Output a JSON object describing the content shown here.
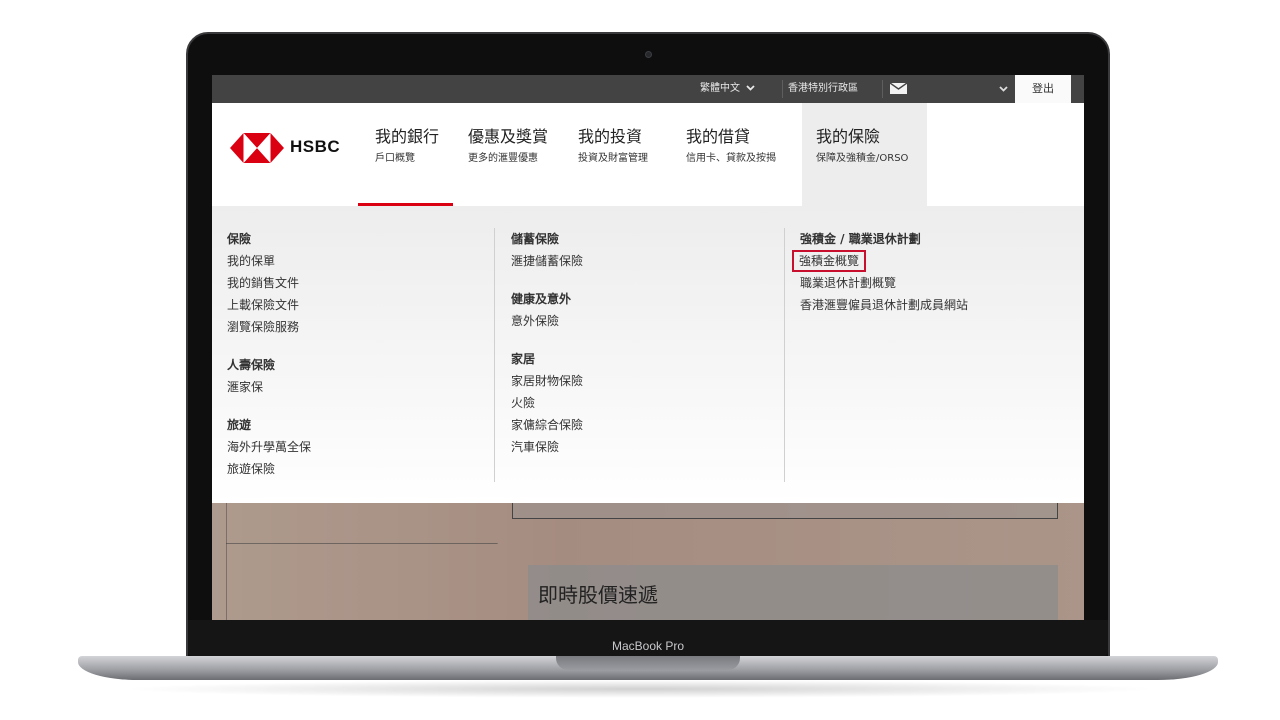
{
  "device": {
    "label": "MacBook Pro"
  },
  "topbar": {
    "language": "繁體中文",
    "region": "香港特別行政區",
    "icons": {
      "dropdown": "chevron-down-icon",
      "mail": "mail-icon"
    },
    "logout": "登出"
  },
  "brand": {
    "name": "HSBC",
    "color": "#db0011"
  },
  "nav": [
    {
      "title": "我的銀行",
      "subtitle": "戶口概覽"
    },
    {
      "title": "優惠及獎賞",
      "subtitle": "更多的滙豐優惠"
    },
    {
      "title": "我的投資",
      "subtitle": "投資及財富管理"
    },
    {
      "title": "我的借貸",
      "subtitle": "信用卡、貸款及按揭"
    },
    {
      "title": "我的保險",
      "subtitle": "保障及強積金/ORSO"
    }
  ],
  "megamenu": {
    "col1": {
      "sec1": {
        "heading": "保險",
        "links": [
          "我的保單",
          "我的銷售文件",
          "上載保險文件",
          "瀏覽保險服務"
        ]
      },
      "sec2": {
        "heading": "人壽保險",
        "links": [
          "滙家保"
        ]
      },
      "sec3": {
        "heading": "旅遊",
        "links": [
          "海外升學萬全保",
          "旅遊保險"
        ]
      }
    },
    "col2": {
      "sec1": {
        "heading": "儲蓄保險",
        "links": [
          "滙捷儲蓄保險"
        ]
      },
      "sec2": {
        "heading": "健康及意外",
        "links": [
          "意外保險"
        ]
      },
      "sec3": {
        "heading": "家居",
        "links": [
          "家居財物保險",
          "火險",
          "家傭綜合保險",
          "汽車保險"
        ]
      }
    },
    "col3": {
      "sec1": {
        "heading": "強積金 / 職業退休計劃",
        "links": [
          "強積金概覽",
          "職業退休計劃概覽",
          "香港滙豐僱員退休計劃成員網站"
        ]
      }
    },
    "highlight_color": "#c8102e"
  },
  "background_page": {
    "heading": "即時股價速遞"
  }
}
